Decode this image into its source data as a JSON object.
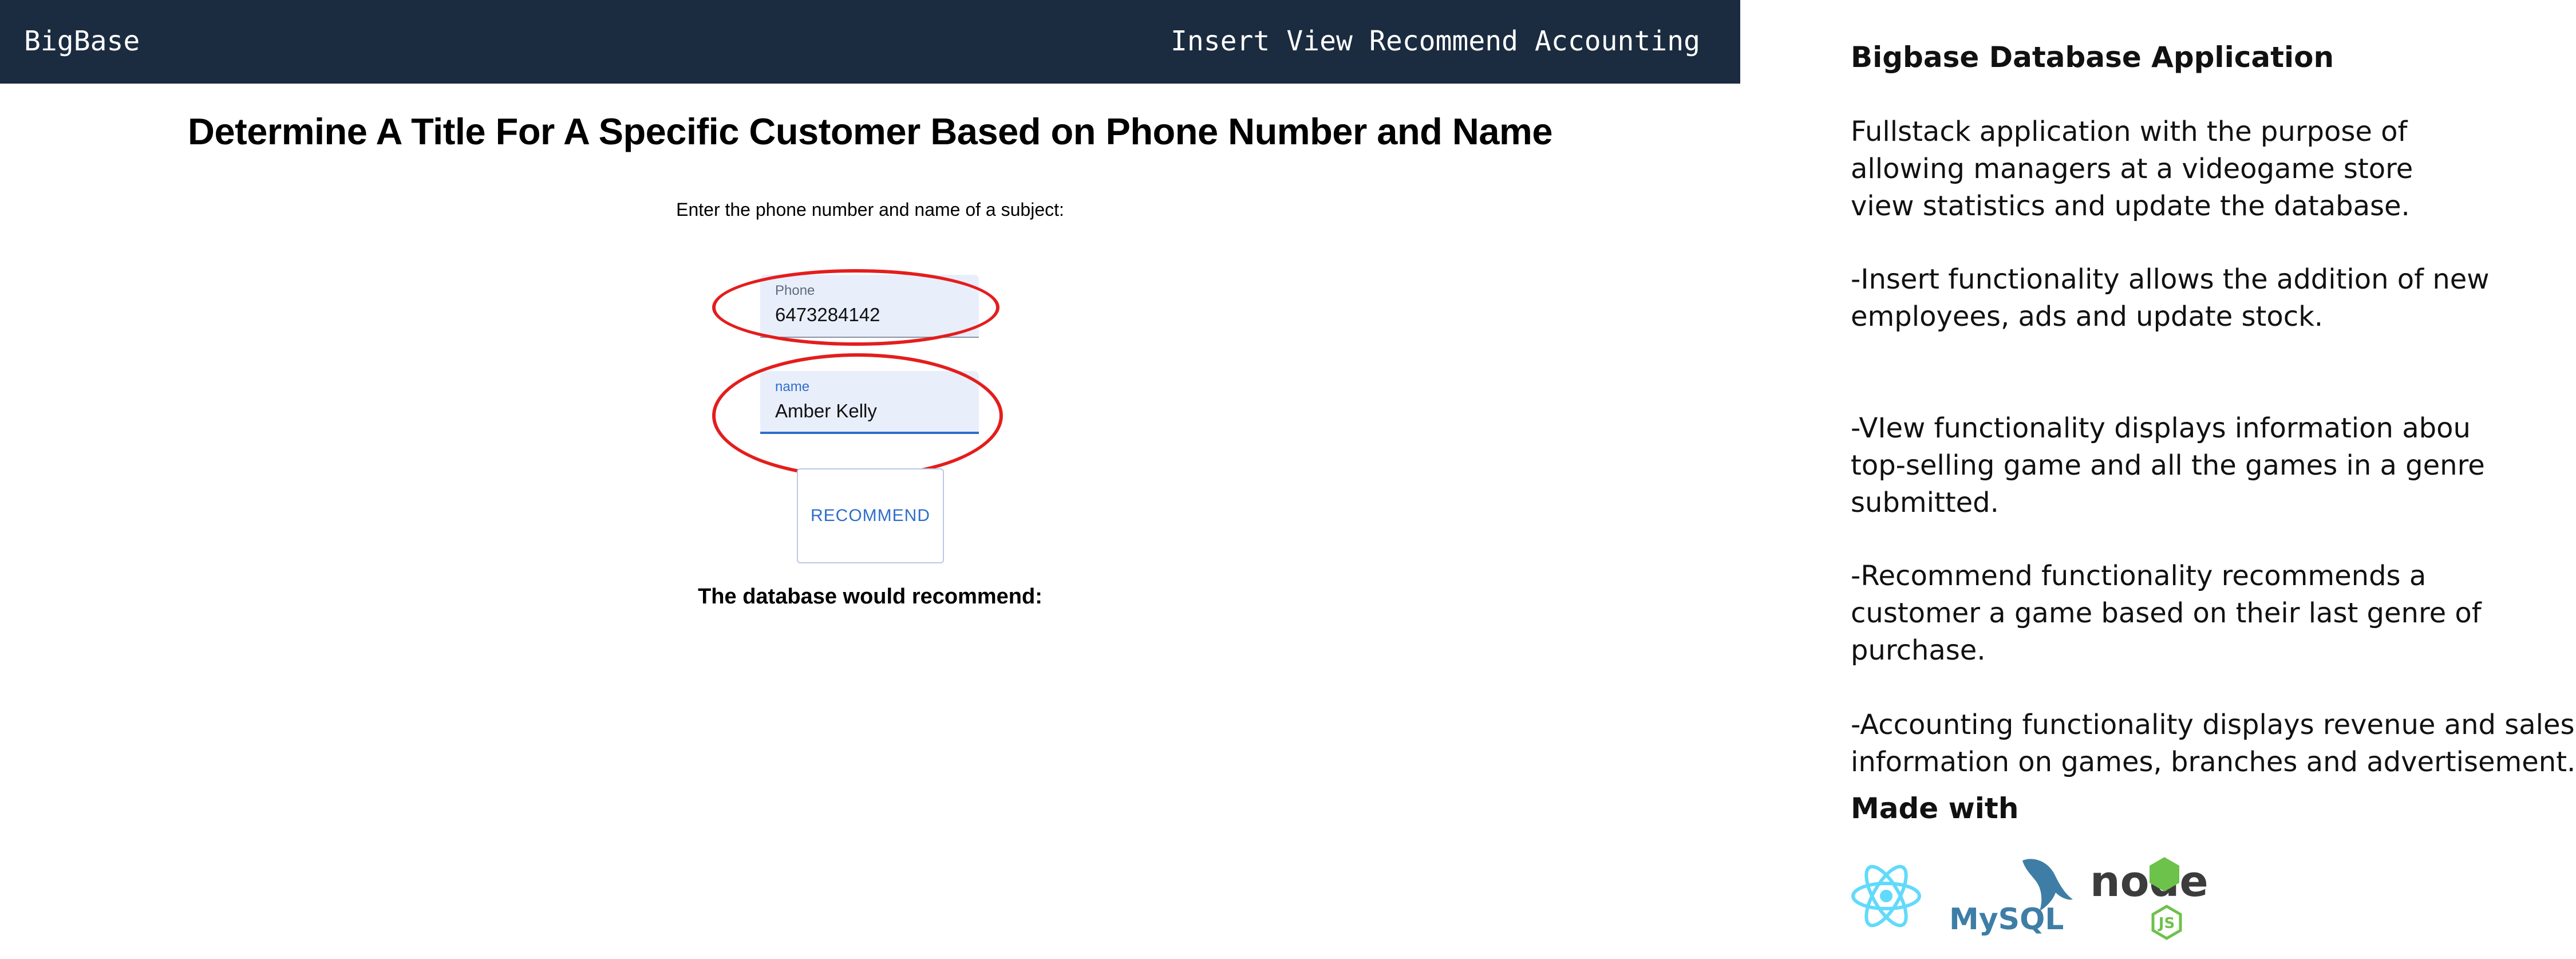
{
  "app": {
    "brand": "BigBase",
    "nav": [
      "Insert",
      "View",
      "Recommend",
      "Accounting"
    ],
    "page_title": "Determine A Title For A Specific Customer Based on Phone Number and Name",
    "instruction": "Enter the phone number and name of a subject:",
    "phone": {
      "label": "Phone",
      "value": "6473284142"
    },
    "name": {
      "label": "name",
      "value": "Amber Kelly"
    },
    "recommend_label": "RECOMMEND",
    "result_label": "The database would recommend:",
    "colors": {
      "navbar": "#1b2b40",
      "accent": "#2f6ec9",
      "highlight": "#e41d1d"
    }
  },
  "description": {
    "title": "Bigbase Database Application",
    "paragraphs": [
      [
        "Fullstack application with the purpose of",
        "allowing managers at a videogame store",
        "view statistics and update the database."
      ],
      [
        "-Insert functionality allows the addition of new",
        "employees, ads and update stock."
      ],
      [
        "-VIew functionality displays information abou",
        "top-selling game and all the games in a genre",
        "submitted."
      ],
      [
        "-Recommend functionality recommends a",
        "customer a game based on their last genre of",
        "purchase."
      ],
      [
        "-Accounting functionality displays revenue and sales",
        "information on games, branches and advertisement."
      ]
    ],
    "made_with": "Made with",
    "tech_logos": [
      {
        "icon": "react-logo-icon"
      },
      {
        "icon": "mysql-logo-icon",
        "wordmark": "MySQL"
      },
      {
        "icon": "nodejs-logo-icon",
        "wordmark": "node",
        "badge": "JS"
      }
    ]
  }
}
